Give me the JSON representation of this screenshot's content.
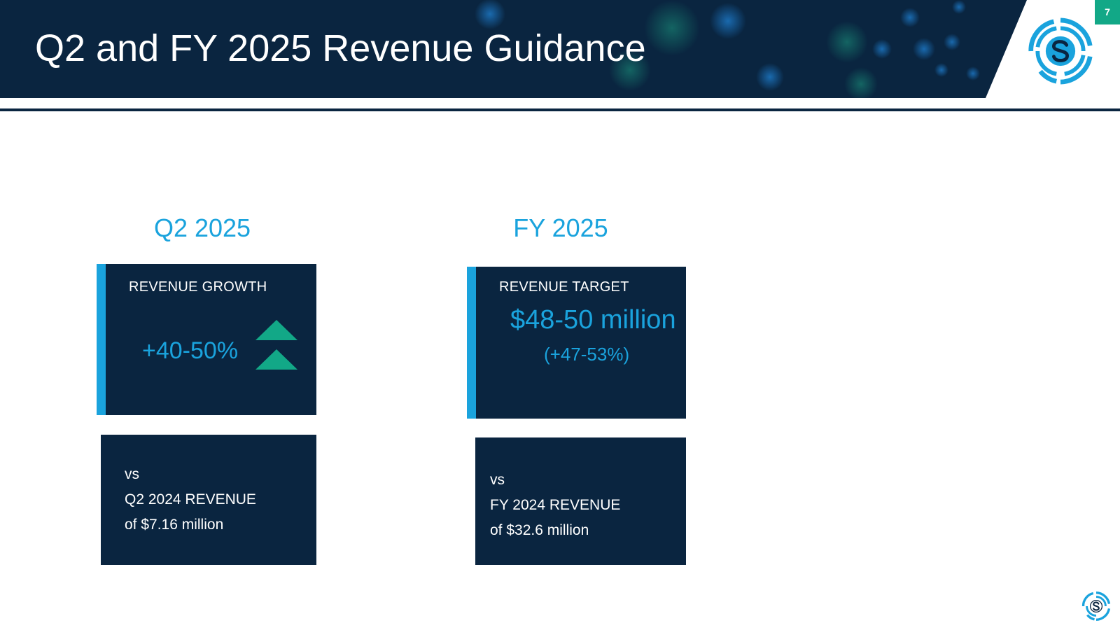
{
  "slide": {
    "title": "Q2 and FY 2025 Revenue Guidance",
    "page_number": "7"
  },
  "brand": {
    "navy": "#0a2540",
    "accent_blue": "#1aa3dd",
    "accent_green": "#12a887",
    "logo_icon": "s-circle-logo-icon"
  },
  "q2": {
    "period_label": "Q2 2025",
    "card_heading": "REVENUE GROWTH",
    "value": "+40-50%",
    "trend_icon": "double-up-arrow-icon",
    "note_vs": "vs",
    "note_line1": "Q2 2024 REVENUE",
    "note_line2": "of $7.16 million"
  },
  "fy": {
    "period_label": "FY 2025",
    "card_heading": "REVENUE TARGET",
    "value": "$48-50 million",
    "subvalue": "(+47-53%)",
    "note_vs": "vs",
    "note_line1": "FY 2024 REVENUE",
    "note_line2": "of $32.6 million"
  }
}
